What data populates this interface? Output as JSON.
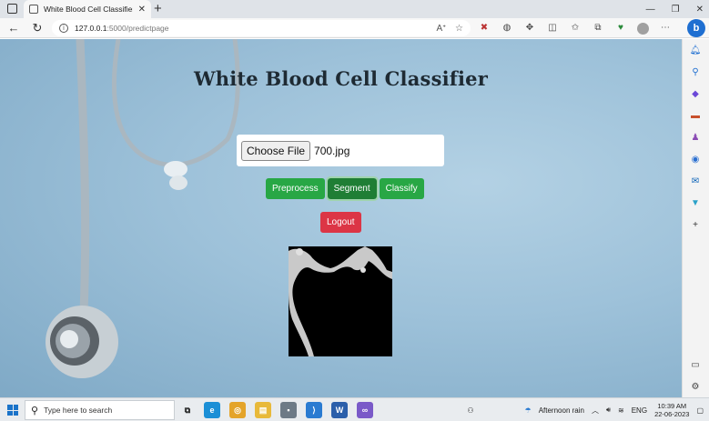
{
  "browser": {
    "tab_title": "White Blood Cell Classifier",
    "url_host": "127.0.0.1",
    "url_path": ":5000/predictpage",
    "window_controls": [
      "—",
      "❐",
      "✕"
    ]
  },
  "page": {
    "title": "White Blood Cell Classifier",
    "file_input": {
      "button_label": "Choose File",
      "selected_file": "700.jpg"
    },
    "actions": [
      {
        "label": "Preprocess",
        "active": false
      },
      {
        "label": "Segment",
        "active": true
      },
      {
        "label": "Classify",
        "active": false
      }
    ],
    "logout_label": "Logout"
  },
  "taskbar": {
    "search_placeholder": "Type here to search",
    "weather": "Afternoon rain",
    "language": "ENG",
    "time": "10:39 AM",
    "date": "22-06-2023"
  },
  "colors": {
    "button_green": "#28a745",
    "button_green_active": "#1f7e35",
    "button_red": "#dc3545",
    "background_blue": "#9dc1d9"
  }
}
